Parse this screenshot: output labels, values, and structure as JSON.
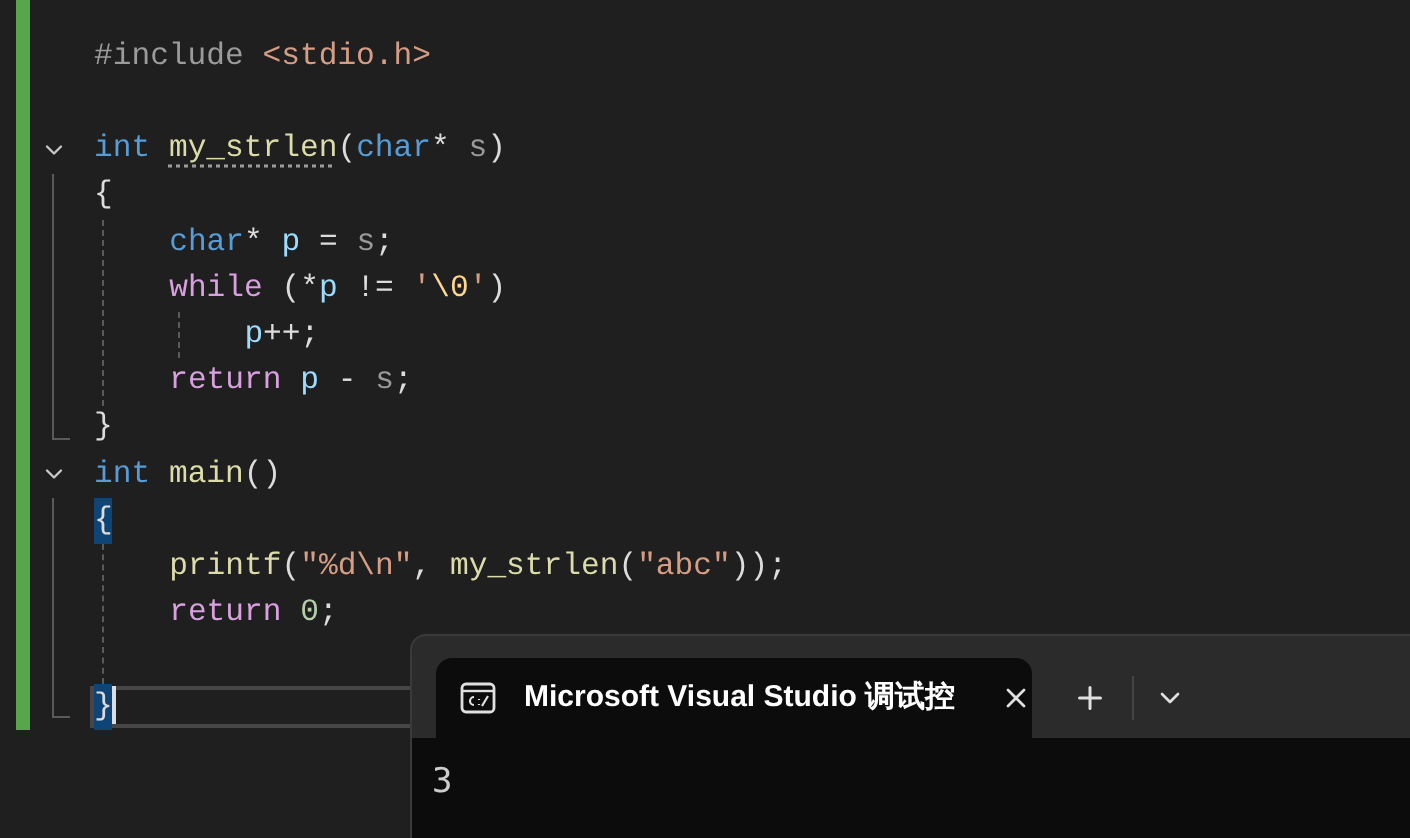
{
  "editor": {
    "lines": [
      {
        "kind": "code",
        "tokens": [
          {
            "text": "#include",
            "kind": "preproc"
          },
          {
            "text": "<stdio.h>",
            "kind": "string",
            "space_before": true
          }
        ]
      },
      {
        "kind": "blank"
      },
      {
        "kind": "code",
        "fold": true,
        "expanded": true,
        "tokens": [
          {
            "text": "int",
            "kind": "keyword"
          },
          {
            "text": "my_strlen",
            "kind": "function",
            "hint": true,
            "space_before": true
          },
          {
            "text": "(",
            "kind": "plain"
          },
          {
            "text": "char",
            "kind": "keyword"
          },
          {
            "text": "* ",
            "kind": "plain"
          },
          {
            "text": "s",
            "kind": "param"
          },
          {
            "text": ")",
            "kind": "plain"
          }
        ],
        "body": [
          {
            "kind": "code",
            "tokens": [
              {
                "text": "{",
                "kind": "plain"
              }
            ],
            "children": [
              {
                "kind": "code",
                "tokens": [
                  {
                    "text": "char",
                    "kind": "keyword"
                  },
                  {
                    "text": "* ",
                    "kind": "plain"
                  },
                  {
                    "text": "p",
                    "kind": "local"
                  },
                  {
                    "text": " = ",
                    "kind": "plain"
                  },
                  {
                    "text": "s",
                    "kind": "param"
                  },
                  {
                    "text": ";",
                    "kind": "plain"
                  }
                ]
              },
              {
                "kind": "code",
                "tokens": [
                  {
                    "text": "while",
                    "kind": "control"
                  },
                  {
                    "text": " (*",
                    "kind": "plain"
                  },
                  {
                    "text": "p",
                    "kind": "local"
                  },
                  {
                    "text": " != ",
                    "kind": "plain"
                  },
                  {
                    "text": "'",
                    "kind": "string"
                  },
                  {
                    "text": "\\0",
                    "kind": "escape"
                  },
                  {
                    "text": "'",
                    "kind": "string"
                  },
                  {
                    "text": ")",
                    "kind": "plain"
                  }
                ],
                "children": [
                  {
                    "kind": "code",
                    "tokens": [
                      {
                        "text": "p",
                        "kind": "local"
                      },
                      {
                        "text": "++;",
                        "kind": "plain"
                      }
                    ]
                  }
                ]
              },
              {
                "kind": "code",
                "tokens": [
                  {
                    "text": "return",
                    "kind": "control"
                  },
                  {
                    "text": "p",
                    "kind": "local",
                    "space_before": true
                  },
                  {
                    "text": " - ",
                    "kind": "plain"
                  },
                  {
                    "text": "s",
                    "kind": "param"
                  },
                  {
                    "text": ";",
                    "kind": "plain"
                  }
                ]
              }
            ]
          },
          {
            "kind": "code",
            "tokens": [
              {
                "text": "}",
                "kind": "plain"
              }
            ]
          }
        ]
      },
      {
        "kind": "code",
        "fold": true,
        "expanded": true,
        "tokens": [
          {
            "text": "int",
            "kind": "keyword"
          },
          {
            "text": "main",
            "kind": "function",
            "space_before": true
          },
          {
            "text": "()",
            "kind": "plain"
          }
        ],
        "body": [
          {
            "kind": "code",
            "tokens": [
              {
                "text": "{",
                "kind": "plain",
                "match": true
              }
            ],
            "children": [
              {
                "kind": "code",
                "tokens": [
                  {
                    "text": "printf",
                    "kind": "function"
                  },
                  {
                    "text": "(",
                    "kind": "plain"
                  },
                  {
                    "text": "\"%d\\n\"",
                    "kind": "string"
                  },
                  {
                    "text": ", ",
                    "kind": "plain"
                  },
                  {
                    "text": "my_strlen",
                    "kind": "function"
                  },
                  {
                    "text": "(",
                    "kind": "plain"
                  },
                  {
                    "text": "\"abc\"",
                    "kind": "string"
                  },
                  {
                    "text": "));",
                    "kind": "plain"
                  }
                ]
              },
              {
                "kind": "code",
                "tokens": [
                  {
                    "text": "return",
                    "kind": "control"
                  },
                  {
                    "text": "0",
                    "kind": "number",
                    "space_before": true
                  },
                  {
                    "text": ";",
                    "kind": "plain"
                  }
                ]
              },
              {
                "kind": "blank"
              }
            ]
          },
          {
            "kind": "code",
            "current": true,
            "tokens": [
              {
                "text": "}",
                "kind": "plain",
                "match": true
              }
            ]
          }
        ]
      }
    ]
  },
  "terminal": {
    "tabs": [
      {
        "title": "Microsoft Visual Studio 调试控",
        "selected": true
      }
    ],
    "output": "3"
  }
}
